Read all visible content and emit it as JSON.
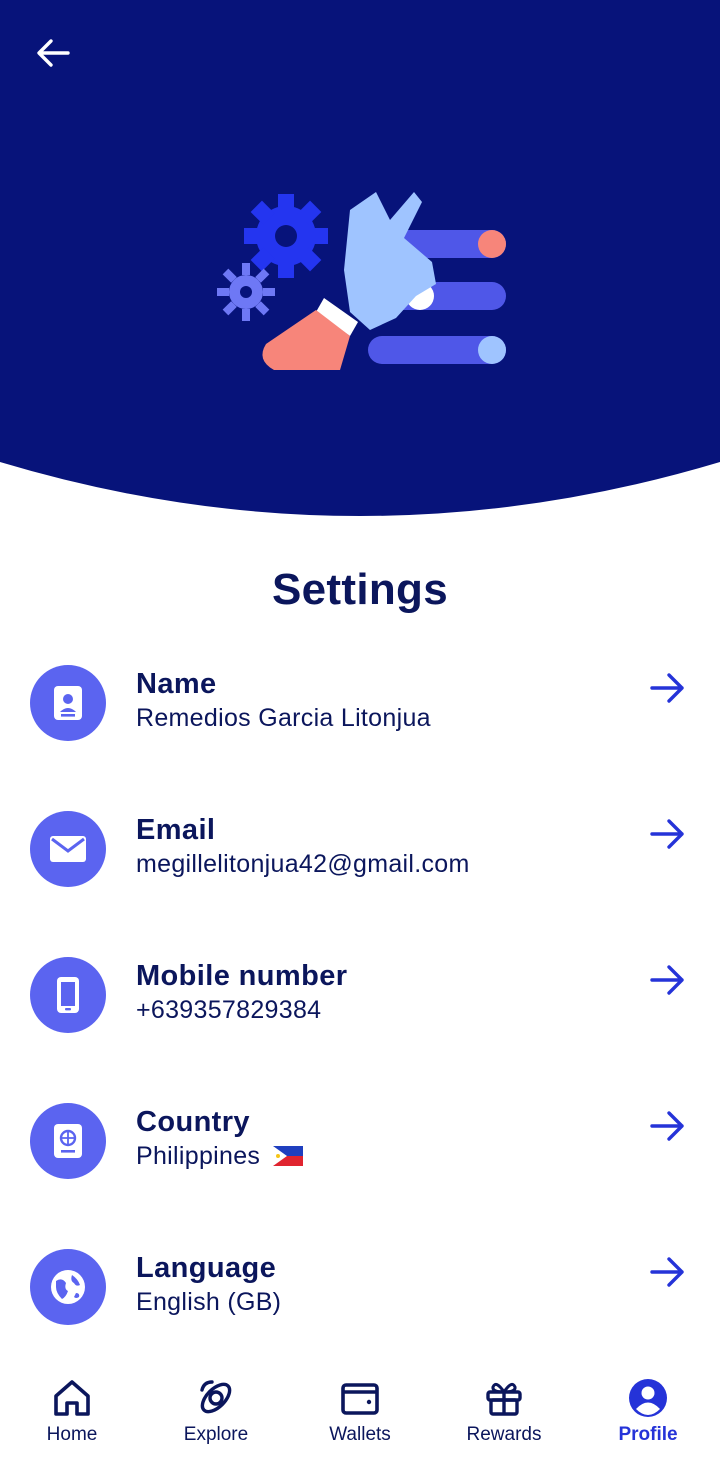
{
  "header": {
    "back_icon": "arrow-left-icon",
    "illustration": "hand-settings-illustration",
    "colors": {
      "background": "#07137a",
      "accent": "#5b64f0"
    }
  },
  "page": {
    "title": "Settings"
  },
  "settings": [
    {
      "label": "Name",
      "value": "Remedios Garcia Litonjua",
      "icon": "id-badge-icon"
    },
    {
      "label": "Email",
      "value": "megillelitonjua42@gmail.com",
      "icon": "envelope-icon"
    },
    {
      "label": "Mobile number",
      "value": "+639357829384",
      "icon": "phone-icon"
    },
    {
      "label": "Country",
      "value": "Philippines",
      "icon": "passport-icon",
      "flag_icon": "philippines-flag-icon"
    },
    {
      "label": "Language",
      "value": "English (GB)",
      "icon": "globe-icon"
    }
  ],
  "nav": {
    "items": [
      {
        "label": "Home",
        "icon": "home-icon"
      },
      {
        "label": "Explore",
        "icon": "explore-icon"
      },
      {
        "label": "Wallets",
        "icon": "wallet-icon"
      },
      {
        "label": "Rewards",
        "icon": "gift-icon"
      },
      {
        "label": "Profile",
        "icon": "profile-icon"
      }
    ],
    "active": "Profile",
    "active_color": "#2533d8"
  }
}
